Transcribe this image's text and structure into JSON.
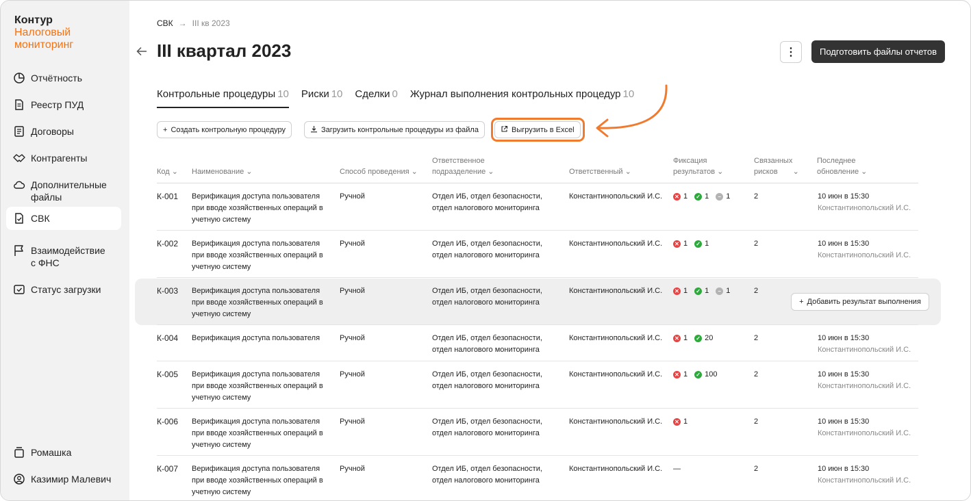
{
  "brand": {
    "line1": "Контур",
    "line2": "Налоговый",
    "line3": "мониторинг"
  },
  "sidebar": {
    "items": [
      {
        "label": "Отчётность",
        "icon": "pie-chart-icon"
      },
      {
        "label": "Реестр ПУД",
        "icon": "document-icon"
      },
      {
        "label": "Договоры",
        "icon": "contract-icon"
      },
      {
        "label": "Контрагенты",
        "icon": "handshake-icon"
      },
      {
        "label": "Дополнительные файлы",
        "icon": "cloud-icon"
      },
      {
        "label": "СВК",
        "icon": "checklist-icon",
        "active": true
      },
      {
        "label": "Взаимодействие с ФНС",
        "icon": "flag-icon"
      },
      {
        "label": "Статус загрузки",
        "icon": "upload-status-icon"
      }
    ],
    "org": {
      "label": "Ромашка",
      "icon": "building-icon"
    },
    "user": {
      "label": "Казимир Малевич",
      "icon": "user-icon"
    }
  },
  "breadcrumb": {
    "root": "СВК",
    "separator": "→",
    "current": "III кв 2023"
  },
  "header": {
    "title": "III квартал 2023",
    "more_label": "⋮",
    "primary_label": "Подготовить файлы отчетов"
  },
  "tabs": [
    {
      "label": "Контрольные процедуры",
      "count": "10",
      "active": true
    },
    {
      "label": "Риски",
      "count": "10"
    },
    {
      "label": "Сделки",
      "count": "0"
    },
    {
      "label": "Журнал выполнения контрольных процедур",
      "count": "10"
    }
  ],
  "toolbar": {
    "create_label": "Создать контрольную процедуру",
    "upload_label": "Загрузить контрольные процедуры из файла",
    "export_label": "Выгрузить в Excel"
  },
  "table": {
    "columns": {
      "code": "Код",
      "name": "Наименование",
      "method": "Способ проведения",
      "dept_1": "Ответственное",
      "dept_2": "подразделение",
      "resp": "Ответственный",
      "fix_1": "Фиксация",
      "fix_2": "результатов",
      "risks_1": "Связанных",
      "risks_2": "рисков",
      "upd_1": "Последнее",
      "upd_2": "обновление"
    },
    "rows": [
      {
        "code": "К-001",
        "name": "Верификация доступа пользователя при вводе хозяйственных операций в учетную систему",
        "method": "Ручной",
        "dept": "Отдел ИБ, отдел безопасности, отдел налогового мониторинга",
        "resp": "Константинопольский И.С.",
        "red": "1",
        "green": "1",
        "gray": "1",
        "dash": "",
        "risks": "2",
        "upd_date": "10 июн в 15:30",
        "upd_who": "Константинопольский И.С."
      },
      {
        "code": "К-002",
        "name": "Верификация доступа пользователя при вводе хозяйственных операций в учетную систему",
        "method": "Ручной",
        "dept": "Отдел ИБ, отдел безопасности, отдел налогового мониторинга",
        "resp": "Константинопольский И.С.",
        "red": "1",
        "green": "1",
        "gray": "",
        "dash": "",
        "risks": "2",
        "upd_date": "10 июн в 15:30",
        "upd_who": "Константинопольский И.С."
      },
      {
        "code": "К-003",
        "name": "Верификация доступа пользователя при вводе хозяйственных операций в учетную систему",
        "method": "Ручной",
        "dept": "Отдел ИБ, отдел безопасности, отдел налогового мониторинга",
        "resp": "Константинопольский И.С.",
        "red": "1",
        "green": "1",
        "gray": "1",
        "dash": "",
        "risks": "2",
        "upd_date": "",
        "upd_who": "",
        "hover": true
      },
      {
        "code": "К-004",
        "name": "Верификация доступа пользователя",
        "method": "Ручной",
        "dept": "Отдел ИБ, отдел безопасности, отдел налогового мониторинга",
        "resp": "Константинопольский И.С.",
        "red": "1",
        "green": "20",
        "gray": "",
        "dash": "",
        "risks": "2",
        "upd_date": "10 июн в 15:30",
        "upd_who": "Константинопольский И.С."
      },
      {
        "code": "К-005",
        "name": "Верификация доступа пользователя при вводе хозяйственных операций в учетную систему",
        "method": "Ручной",
        "dept": "Отдел ИБ, отдел безопасности, отдел налогового мониторинга",
        "resp": "Константинопольский И.С.",
        "red": "1",
        "green": "100",
        "gray": "",
        "dash": "",
        "risks": "2",
        "upd_date": "10 июн в 15:30",
        "upd_who": "Константинопольский И.С."
      },
      {
        "code": "К-006",
        "name": "Верификация доступа пользователя при вводе хозяйственных операций в учетную систему",
        "method": "Ручной",
        "dept": "Отдел ИБ, отдел безопасности, отдел налогового мониторинга",
        "resp": "Константинопольский И.С.",
        "red": "1",
        "green": "",
        "gray": "",
        "dash": "",
        "risks": "2",
        "upd_date": "10 июн в 15:30",
        "upd_who": "Константинопольский И.С."
      },
      {
        "code": "К-007",
        "name": "Верификация доступа пользователя при вводе хозяйственных операций в учетную систему",
        "method": "Ручной",
        "dept": "Отдел ИБ, отдел безопасности, отдел налогового мониторинга",
        "resp": "Константинопольский И.С.",
        "red": "",
        "green": "",
        "gray": "",
        "dash": "—",
        "risks": "2",
        "upd_date": "10 июн в 15:30",
        "upd_who": "Константинопольский И.С."
      }
    ],
    "add_result_label": "Добавить результат выполнения"
  },
  "colors": {
    "accent": "#f7720f",
    "highlight": "#f07a2e",
    "primary_button": "#333333",
    "error": "#e94343",
    "success": "#2daa3b",
    "neutral": "#b3b3b3"
  }
}
